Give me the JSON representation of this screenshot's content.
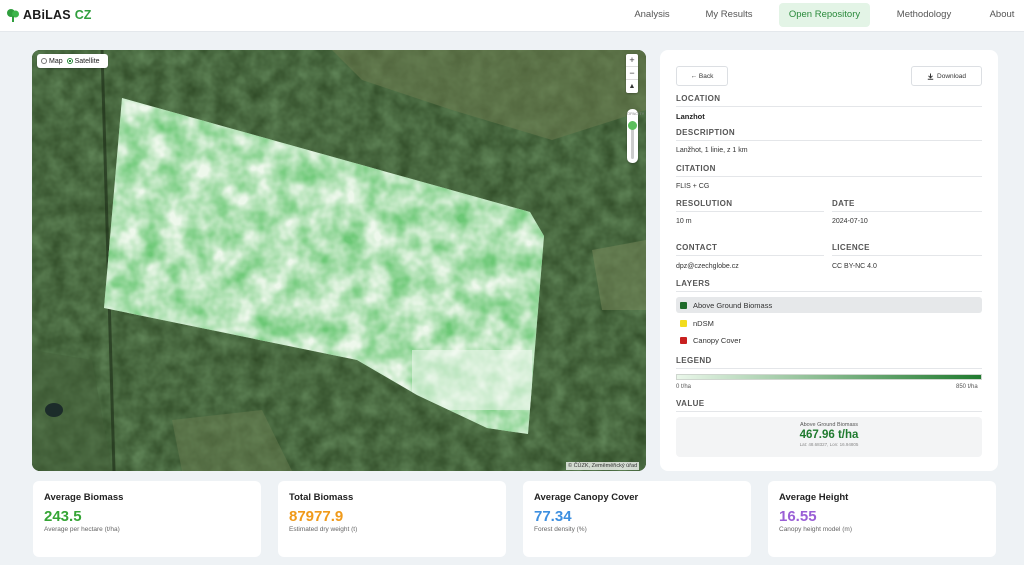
{
  "app": {
    "brand": "ABiLAS",
    "brand_suffix": "CZ"
  },
  "nav": {
    "items": [
      {
        "label": "Analysis",
        "active": false
      },
      {
        "label": "My Results",
        "active": false
      },
      {
        "label": "Open Repository",
        "active": true
      },
      {
        "label": "Methodology",
        "active": false
      },
      {
        "label": "About",
        "active": false
      }
    ]
  },
  "map": {
    "map_type_options": [
      {
        "label": "Map",
        "selected": false
      },
      {
        "label": "Satellite",
        "selected": true
      }
    ],
    "zoom_in": "+",
    "zoom_out": "−",
    "reset_north": "▲",
    "opacity_label": "OPACITY",
    "attribution": "© ČÚZK, Zeměměřický úřad"
  },
  "panel": {
    "back_label": "← Back",
    "download_label": "Download",
    "location": {
      "title": "LOCATION",
      "value": "Lanzhot"
    },
    "description": {
      "title": "DESCRIPTION",
      "value": "Lanžhot, 1 linie, z 1 km"
    },
    "citation": {
      "title": "CITATION",
      "value": "FLIS + CG"
    },
    "resolution": {
      "title": "RESOLUTION",
      "value": "10 m"
    },
    "date": {
      "title": "DATE",
      "value": "2024-07-10"
    },
    "contact": {
      "title": "CONTACT",
      "value": "dpz@czechglobe.cz"
    },
    "licence": {
      "title": "LICENCE",
      "value": "CC BY-NC 4.0"
    },
    "layers": {
      "title": "LAYERS",
      "items": [
        {
          "label": "Above Ground Biomass",
          "color": "#1f6b2a",
          "active": true
        },
        {
          "label": "nDSM",
          "color": "#f2dc1e",
          "active": false
        },
        {
          "label": "Canopy Cover",
          "color": "#c8201f",
          "active": false
        }
      ]
    },
    "legend": {
      "title": "LEGEND",
      "min": "0 t/ha",
      "max": "850 t/ha",
      "color_min": "#eaf7ea",
      "color_max": "#1f7a2e"
    },
    "value": {
      "title": "VALUE",
      "layer": "Above Ground Biomass",
      "reading": "467.96 t/ha",
      "coords": "Lat: 48.68327, Lon: 16.94805"
    }
  },
  "stats": [
    {
      "title": "Average Biomass",
      "value": "243.5",
      "subtitle": "Average per hectare (t/ha)",
      "color": "#35a535"
    },
    {
      "title": "Total Biomass",
      "value": "87977.9",
      "subtitle": "Estimated dry weight (t)",
      "color": "#f09a1a"
    },
    {
      "title": "Average Canopy Cover",
      "value": "77.34",
      "subtitle": "Forest density (%)",
      "color": "#3d8fe0"
    },
    {
      "title": "Average Height",
      "value": "16.55",
      "subtitle": "Canopy height model (m)",
      "color": "#9a5fd6"
    }
  ]
}
